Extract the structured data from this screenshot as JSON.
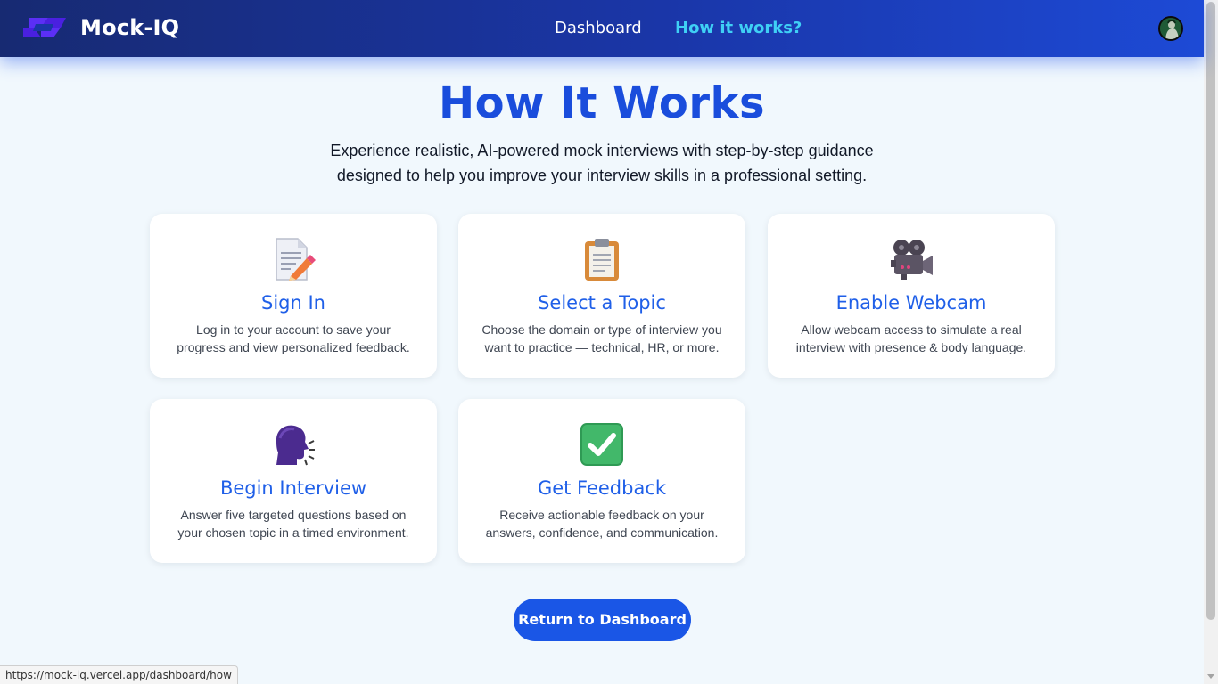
{
  "brand": {
    "name": "Mock-IQ",
    "logo_icon": "infinity-link-icon",
    "accent": "#5b2ff5"
  },
  "nav": {
    "links": [
      {
        "label": "Dashboard",
        "active": false
      },
      {
        "label": "How it works?",
        "active": true
      }
    ],
    "avatar_icon": "user-avatar-icon"
  },
  "hero": {
    "title": "How It Works",
    "subtitle": "Experience realistic, AI-powered mock interviews with step-by-step guidance designed to help you improve your interview skills in a professional setting."
  },
  "steps": [
    {
      "icon": "memo-pencil-icon",
      "title": "Sign In",
      "description": "Log in to your account to save your progress and view personalized feedback."
    },
    {
      "icon": "clipboard-icon",
      "title": "Select a Topic",
      "description": "Choose the domain or type of interview you want to practice — technical, HR, or more."
    },
    {
      "icon": "movie-camera-icon",
      "title": "Enable Webcam",
      "description": "Allow webcam access to simulate a real interview with presence & body language."
    },
    {
      "icon": "speaking-head-icon",
      "title": "Begin Interview",
      "description": "Answer five targeted questions based on your chosen topic in a timed environment."
    },
    {
      "icon": "check-mark-button-icon",
      "title": "Get Feedback",
      "description": "Receive actionable feedback on your answers, confidence, and communication."
    }
  ],
  "actions": {
    "return_label": "Return to Dashboard"
  },
  "status_bar": {
    "url": "https://mock-iq.vercel.app/dashboard/how"
  },
  "colors": {
    "nav_start": "#172a72",
    "nav_end": "#1d4ad6",
    "title": "#1a4ddc",
    "card_title": "#1f5fe8",
    "active_link": "#3fd0f5",
    "button": "#1a56e6",
    "background": "#f1f8fd"
  }
}
